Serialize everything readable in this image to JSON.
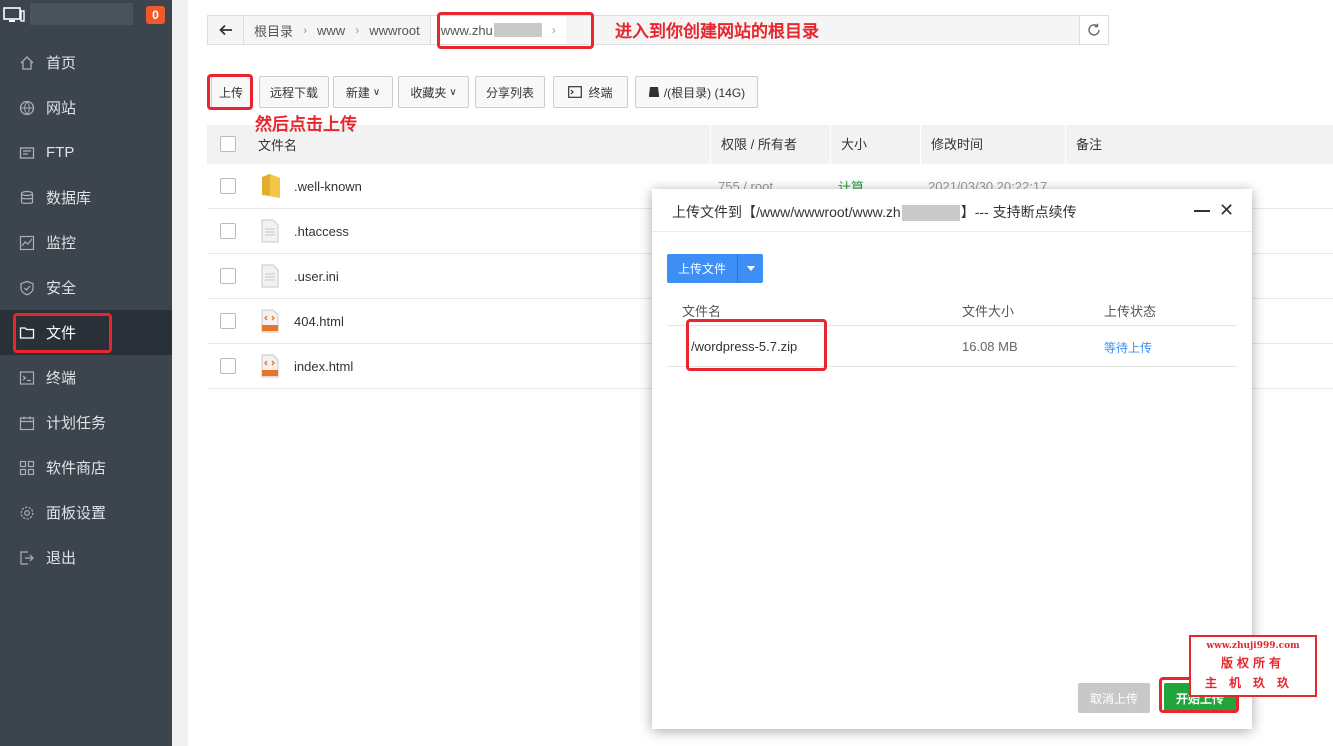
{
  "sidebar": {
    "badge": "0",
    "items": [
      {
        "label": "首页",
        "icon": "home-icon"
      },
      {
        "label": "网站",
        "icon": "globe-icon"
      },
      {
        "label": "FTP",
        "icon": "ftp-icon"
      },
      {
        "label": "数据库",
        "icon": "database-icon"
      },
      {
        "label": "监控",
        "icon": "monitor-icon"
      },
      {
        "label": "安全",
        "icon": "shield-icon"
      },
      {
        "label": "文件",
        "icon": "folder-icon"
      },
      {
        "label": "终端",
        "icon": "terminal-icon"
      },
      {
        "label": "计划任务",
        "icon": "calendar-icon"
      },
      {
        "label": "软件商店",
        "icon": "apps-icon"
      },
      {
        "label": "面板设置",
        "icon": "gear-icon"
      },
      {
        "label": "退出",
        "icon": "logout-icon"
      }
    ],
    "active": "文件"
  },
  "breadcrumb": {
    "segments": [
      "根目录",
      "www",
      "wwwroot"
    ],
    "current": "www.zhu"
  },
  "toolbar": {
    "upload": "上传",
    "remote_download": "远程下载",
    "new": "新建",
    "favorites": "收藏夹",
    "share_list": "分享列表",
    "terminal": "终端",
    "disk": "/(根目录) (14G)"
  },
  "table": {
    "headers": {
      "name": "文件名",
      "perm": "权限 / 所有者",
      "size": "大小",
      "mtime": "修改时间",
      "note": "备注"
    },
    "rows": [
      {
        "name": ".well-known",
        "type": "folder",
        "perm": "755 / root",
        "size": "计算",
        "mtime": "2021/03/30 20:22:17"
      },
      {
        "name": ".htaccess",
        "type": "file"
      },
      {
        "name": ".user.ini",
        "type": "file"
      },
      {
        "name": "404.html",
        "type": "html"
      },
      {
        "name": "index.html",
        "type": "html"
      }
    ]
  },
  "modal": {
    "title_prefix": "上传文件到【/www/wwwroot/www.zh",
    "title_suffix": "】--- 支持断点续传",
    "upload_files": "上传文件",
    "headers": {
      "name": "文件名",
      "size": "文件大小",
      "status": "上传状态"
    },
    "file": {
      "name": "/wordpress-5.7.zip",
      "size": "16.08 MB",
      "status": "等待上传"
    },
    "cancel": "取消上传",
    "start": "开始上传"
  },
  "annotations": {
    "enter_dir": "进入到你创建网站的根目录",
    "click_upload": "然后点击上传"
  },
  "watermark": {
    "url": "www.zhuji999.com",
    "rights": "版权所有",
    "name": "主机玖玖"
  }
}
